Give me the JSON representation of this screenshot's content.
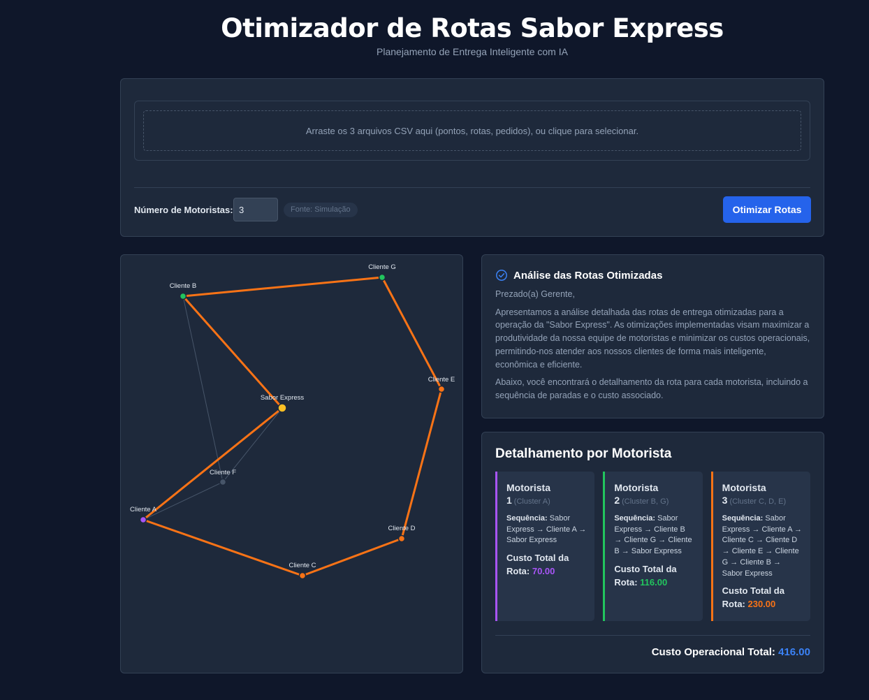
{
  "header": {
    "title": "Otimizador de Rotas Sabor Express",
    "subtitle": "Planejamento de Entrega Inteligente com IA"
  },
  "upload": {
    "dropzone_text": "Arraste os 3 arquivos CSV aqui (pontos, rotas, pedidos), ou clique para selecionar.",
    "drivers_label": "Número de Motoristas:",
    "drivers_value": "3",
    "source_badge": "Fonte: Simulação",
    "optimize_label": "Otimizar Rotas"
  },
  "map": {
    "nodes": [
      {
        "id": "G",
        "label": "Cliente G",
        "color": "#22c55e"
      },
      {
        "id": "B",
        "label": "Cliente B",
        "color": "#22c55e"
      },
      {
        "id": "E",
        "label": "Cliente E",
        "color": "#f97316"
      },
      {
        "id": "SE",
        "label": "Sabor Express",
        "color": "#fbbf24"
      },
      {
        "id": "F",
        "label": "Cliente F",
        "color": "#475569"
      },
      {
        "id": "A",
        "label": "Cliente A",
        "color": "#a855f7"
      },
      {
        "id": "D",
        "label": "Cliente D",
        "color": "#f97316"
      },
      {
        "id": "C",
        "label": "Cliente C",
        "color": "#f97316"
      }
    ],
    "route_edges": [
      [
        "SE",
        "A"
      ],
      [
        "A",
        "C"
      ],
      [
        "C",
        "D"
      ],
      [
        "D",
        "E"
      ],
      [
        "E",
        "G"
      ],
      [
        "G",
        "B"
      ],
      [
        "B",
        "SE"
      ]
    ],
    "inactive_edges": [
      [
        "B",
        "F"
      ],
      [
        "F",
        "A"
      ],
      [
        "F",
        "SE"
      ]
    ],
    "route_color": "#f97316",
    "inactive_color": "#475569"
  },
  "analysis": {
    "title": "Análise das Rotas Otimizadas",
    "greeting": "Prezado(a) Gerente,",
    "paragraph1": "Apresentamos a análise detalhada das rotas de entrega otimizadas para a operação da \"Sabor Express\". As otimizações implementadas visam maximizar a produtividade da nossa equipe de motoristas e minimizar os custos operacionais, permitindo-nos atender aos nossos clientes de forma mais inteligente, econômica e eficiente.",
    "paragraph2": "Abaixo, você encontrará o detalhamento da rota para cada motorista, incluindo a sequência de paradas e o custo associado."
  },
  "detail": {
    "title": "Detalhamento por Motorista",
    "drivers": [
      {
        "name": "Motorista",
        "number": "1",
        "cluster": "(Cluster A)",
        "seq_label": "Sequência:",
        "sequence": "Sabor Express → Cliente A → Sabor Express",
        "cost_label": "Custo Total da Rota:",
        "cost": "70.00",
        "color": "#a855f7"
      },
      {
        "name": "Motorista",
        "number": "2",
        "cluster": "(Cluster B, G)",
        "seq_label": "Sequência:",
        "sequence": "Sabor Express → Cliente B → Cliente G → Cliente B → Sabor Express",
        "cost_label": "Custo Total da Rota:",
        "cost": "116.00",
        "color": "#22c55e"
      },
      {
        "name": "Motorista",
        "number": "3",
        "cluster": "(Cluster C, D, E)",
        "seq_label": "Sequência:",
        "sequence": "Sabor Express → Cliente A → Cliente C → Cliente D → Cliente E → Cliente G → Cliente B → Sabor Express",
        "cost_label": "Custo Total da Rota:",
        "cost": "230.00",
        "color": "#f97316"
      }
    ],
    "total_label": "Custo Operacional Total:",
    "total_value": "416.00"
  }
}
